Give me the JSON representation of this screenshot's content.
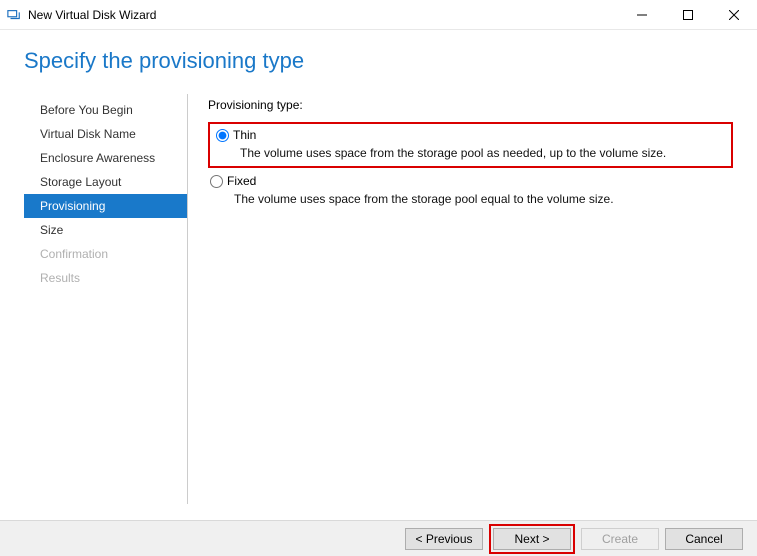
{
  "titlebar": {
    "title": "New Virtual Disk Wizard"
  },
  "page_title": "Specify the provisioning type",
  "sidebar": {
    "items": [
      {
        "label": "Before You Begin",
        "state": "normal"
      },
      {
        "label": "Virtual Disk Name",
        "state": "normal"
      },
      {
        "label": "Enclosure Awareness",
        "state": "normal"
      },
      {
        "label": "Storage Layout",
        "state": "normal"
      },
      {
        "label": "Provisioning",
        "state": "selected"
      },
      {
        "label": "Size",
        "state": "normal"
      },
      {
        "label": "Confirmation",
        "state": "disabled"
      },
      {
        "label": "Results",
        "state": "disabled"
      }
    ]
  },
  "main": {
    "section_label": "Provisioning type:",
    "options": [
      {
        "name": "Thin",
        "description": "The volume uses space from the storage pool as needed, up to the volume size.",
        "selected": true,
        "highlighted": true
      },
      {
        "name": "Fixed",
        "description": "The volume uses space from the storage pool equal to the volume size.",
        "selected": false,
        "highlighted": false
      }
    ]
  },
  "footer": {
    "previous": "< Previous",
    "next": "Next >",
    "create": "Create",
    "cancel": "Cancel"
  }
}
